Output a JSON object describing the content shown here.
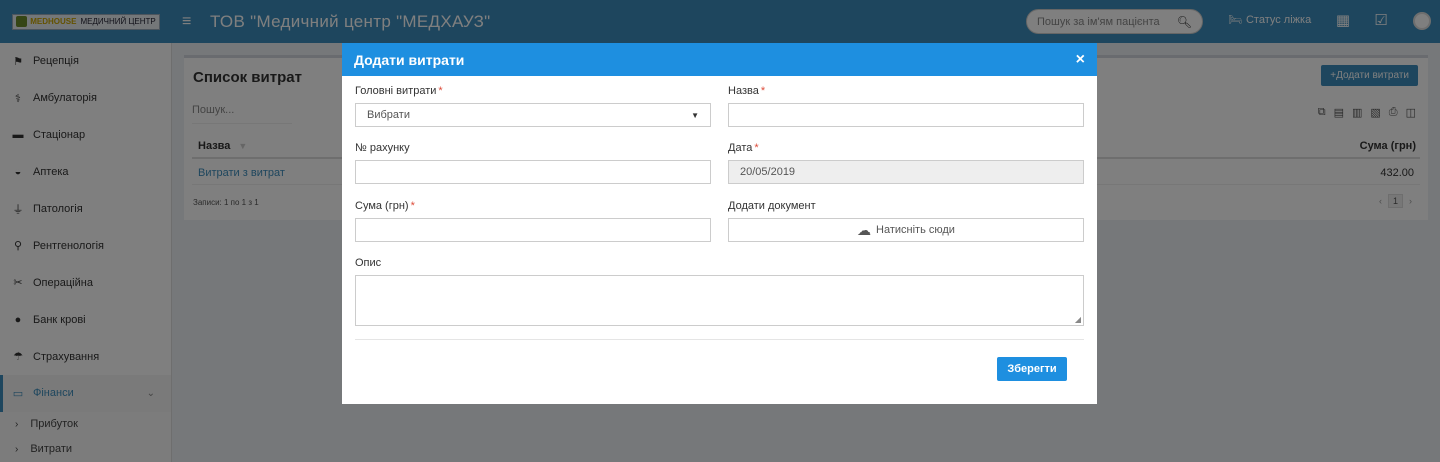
{
  "topbar": {
    "logo_brand": "MEDHOUSE",
    "logo_sub": "МЕДИЧНИЙ ЦЕНТР",
    "title": "ТОВ \"Медичний центр \"МЕДХАУЗ\"",
    "search_placeholder": "Пошук за ім'ям пацієнта",
    "bed_status": "Статус ліжка"
  },
  "sidebar": {
    "items": [
      {
        "label": "Рецепція",
        "icon": "sitemap-icon"
      },
      {
        "label": "Амбулаторія",
        "icon": "stethoscope-icon"
      },
      {
        "label": "Стаціонар",
        "icon": "bed-icon"
      },
      {
        "label": "Аптека",
        "icon": "mortar-icon"
      },
      {
        "label": "Патологія",
        "icon": "flask-icon"
      },
      {
        "label": "Рентгенологія",
        "icon": "xray-icon"
      },
      {
        "label": "Операційна",
        "icon": "scissors-icon"
      },
      {
        "label": "Банк крові",
        "icon": "drop-icon"
      },
      {
        "label": "Страхування",
        "icon": "umbrella-icon"
      },
      {
        "label": "Фінанси",
        "icon": "money-icon"
      }
    ],
    "subitems": [
      "Прибуток",
      "Витрати"
    ]
  },
  "panel": {
    "title": "Список витрат",
    "add_button": "Додати витрати",
    "search_placeholder": "Пошук...",
    "col_name": "Назва",
    "col_sum": "Сума (грн)",
    "rows": [
      {
        "name": "Витрати з витрат",
        "sum": "432.00"
      }
    ],
    "records": "Записи: 1 по 1 з 1",
    "page": "1"
  },
  "modal": {
    "title": "Додати витрати",
    "close": "×",
    "main_expense_label": "Головні витрати",
    "main_expense_value": "Вибрати",
    "name_label": "Назва",
    "name_value": "",
    "account_label": "№ рахунку",
    "account_value": "",
    "date_label": "Дата",
    "date_value": "20/05/2019",
    "sum_label": "Сума (грн)",
    "sum_value": "",
    "doc_label": "Додати документ",
    "doc_button": "Натисніть сюди",
    "desc_label": "Опис",
    "save": "Зберегти"
  },
  "colors": {
    "header": "#3c8dbc",
    "modal_header": "#1e8fe0",
    "required": "#dd4b39"
  }
}
